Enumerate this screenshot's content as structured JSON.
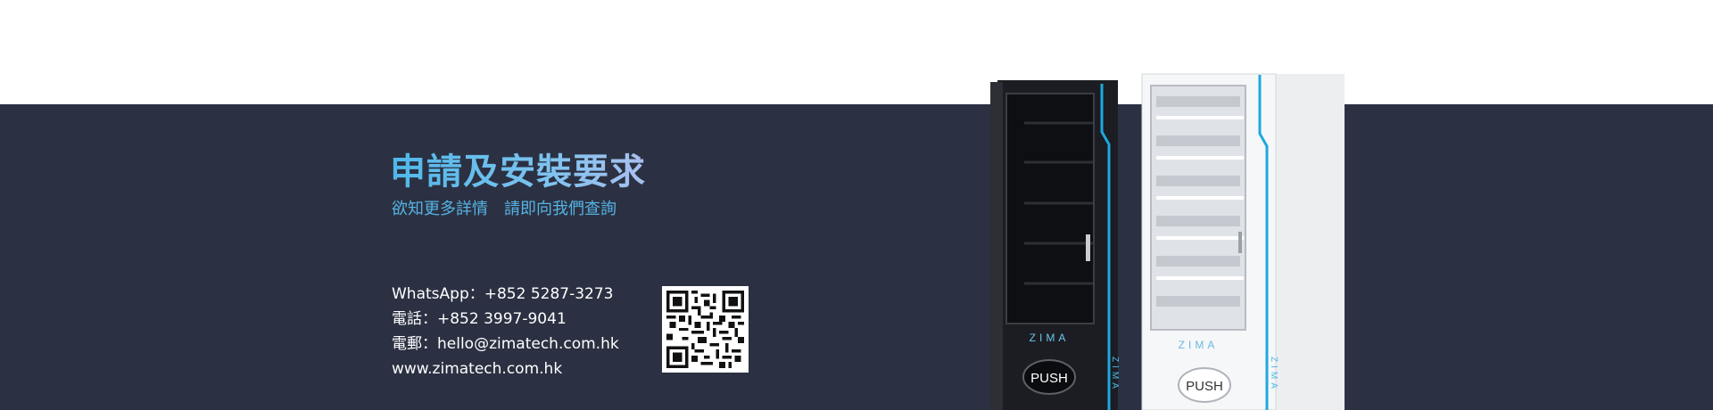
{
  "section": {
    "title": "申請及安裝要求",
    "subtitle": "欲知更多詳情　請即向我們查詢"
  },
  "contact": {
    "whatsapp": "WhatsApp：+852 5287-3273",
    "phone": "電話：+852 3997-9041",
    "email": "電郵：hello@zimatech.com.hk",
    "website": "www.zimatech.com.hk"
  },
  "machines": {
    "brand": "ZIMA",
    "push_label": "PUSH"
  },
  "colors": {
    "band": "#2b3142",
    "accent": "#4fb8ea",
    "machine_dark": "#1b1d22",
    "machine_light": "#f4f5f6"
  }
}
